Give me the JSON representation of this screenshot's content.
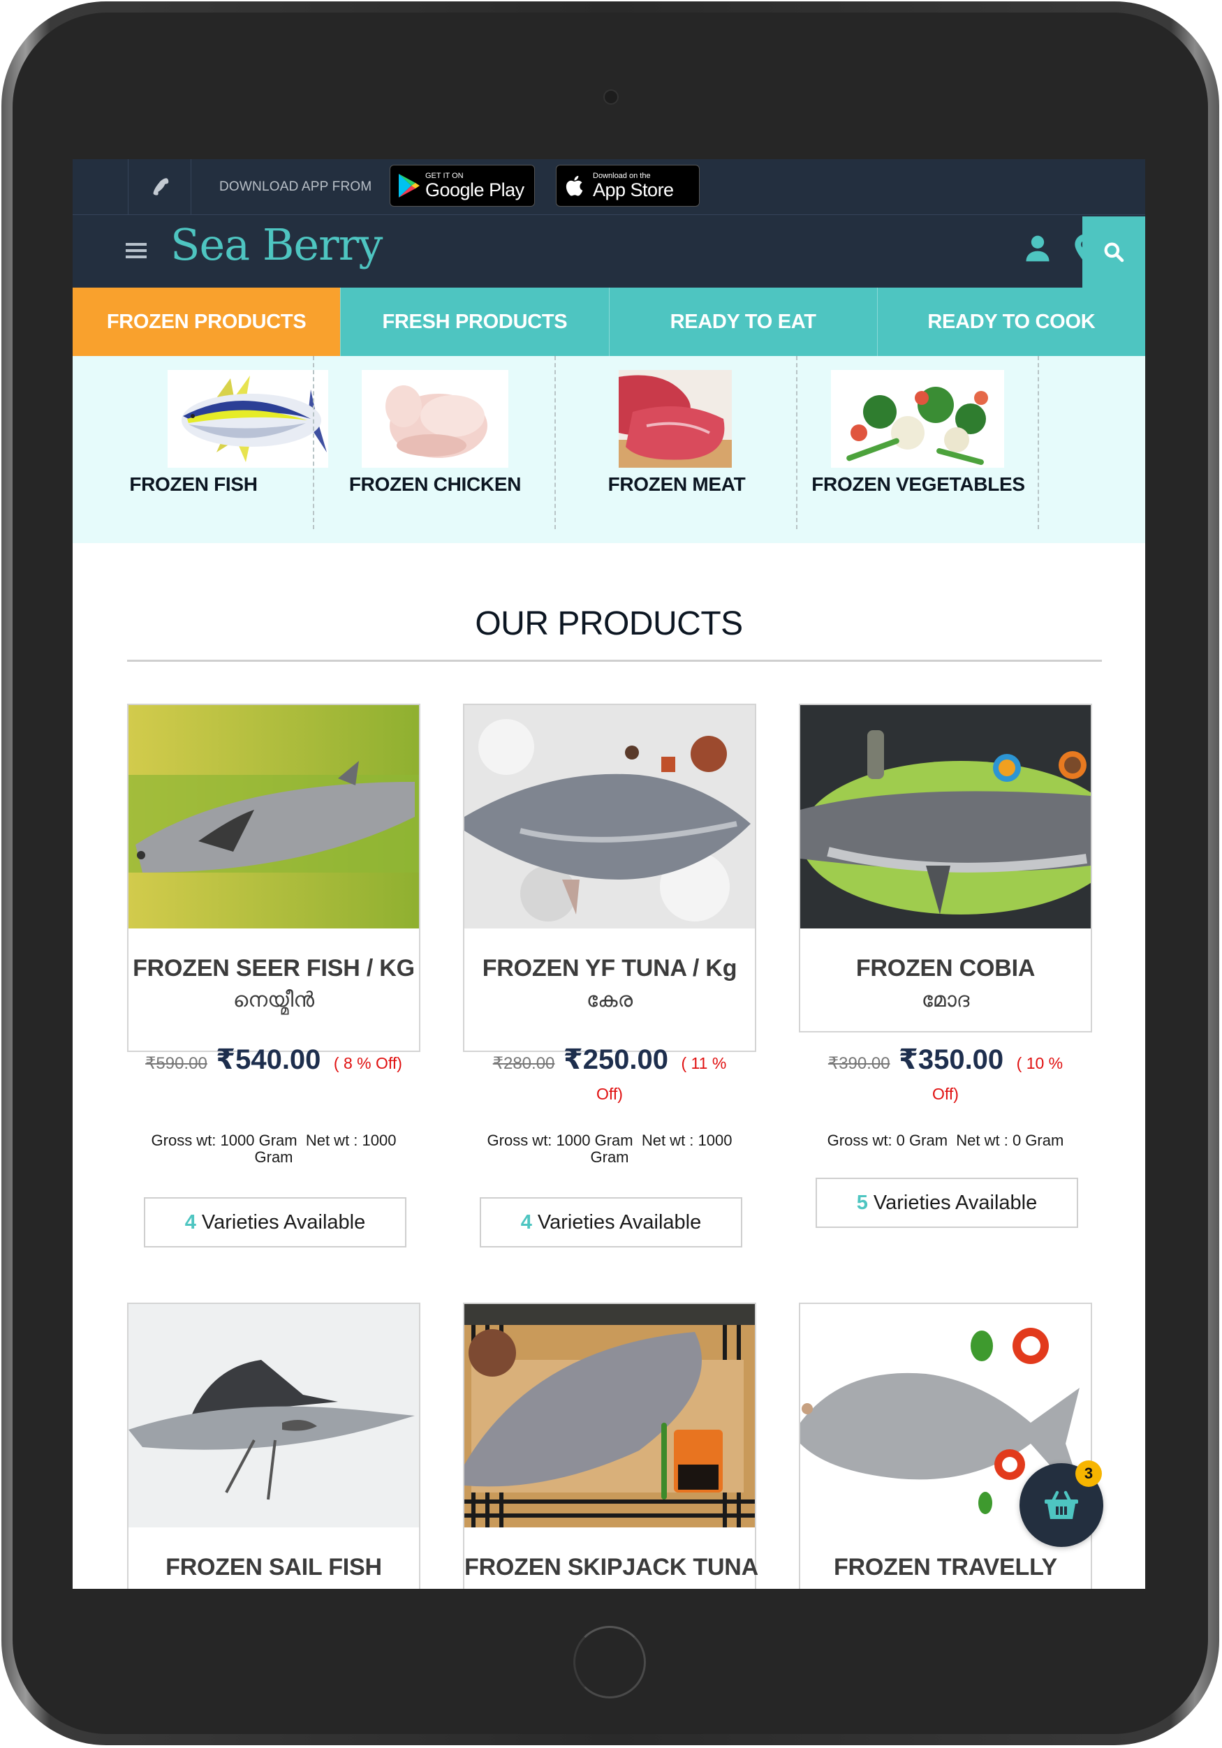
{
  "topbar": {
    "download_label": "DOWNLOAD APP FROM",
    "google_play": {
      "small": "GET IT ON",
      "big": "Google Play"
    },
    "app_store": {
      "small": "Download on the",
      "big": "App Store"
    }
  },
  "header": {
    "logo": "Sea Berry"
  },
  "colors": {
    "navy": "#232f3f",
    "teal": "#4ec5c1",
    "orange": "#f9a12d",
    "price_blue": "#1d2e4d",
    "discount_red": "#e01010",
    "badge_yellow": "#f7b500"
  },
  "tabs": [
    {
      "label": "FROZEN PRODUCTS",
      "active": true
    },
    {
      "label": "FRESH PRODUCTS",
      "active": false
    },
    {
      "label": "READY TO EAT",
      "active": false
    },
    {
      "label": "READY TO COOK",
      "active": false
    }
  ],
  "subcategories": [
    {
      "label": "FROZEN FISH"
    },
    {
      "label": "FROZEN CHICKEN"
    },
    {
      "label": "FROZEN MEAT"
    },
    {
      "label": "FROZEN VEGETABLES"
    }
  ],
  "section": {
    "title": "OUR PRODUCTS"
  },
  "products": [
    {
      "title": "FROZEN SEER FISH / KG",
      "local_name": "നെയ്മീൻ",
      "old_price": "₹590.00",
      "price": "₹540.00",
      "discount": "( 8 % Off)",
      "gross_wt": "Gross wt: 1000 Gram",
      "net_wt": "Net wt : 1000 Gram",
      "varieties_count": "4",
      "varieties_label": "Varieties Available"
    },
    {
      "title": "FROZEN YF TUNA / Kg",
      "local_name": "കേര",
      "old_price": "₹280.00",
      "price": "₹250.00",
      "discount": "( 11 % Off)",
      "gross_wt": "Gross wt: 1000 Gram",
      "net_wt": "Net wt : 1000 Gram",
      "varieties_count": "4",
      "varieties_label": "Varieties Available"
    },
    {
      "title": "FROZEN COBIA",
      "local_name": "മോദ",
      "old_price": "₹390.00",
      "price": "₹350.00",
      "discount": "( 10 % Off)",
      "gross_wt": "Gross wt: 0 Gram",
      "net_wt": "Net wt : 0 Gram",
      "varieties_count": "5",
      "varieties_label": "Varieties Available"
    },
    {
      "title": "FROZEN SAIL FISH"
    },
    {
      "title": "FROZEN SKIPJACK TUNA"
    },
    {
      "title": "FROZEN TRAVELLY"
    }
  ],
  "cart": {
    "count": "3"
  }
}
